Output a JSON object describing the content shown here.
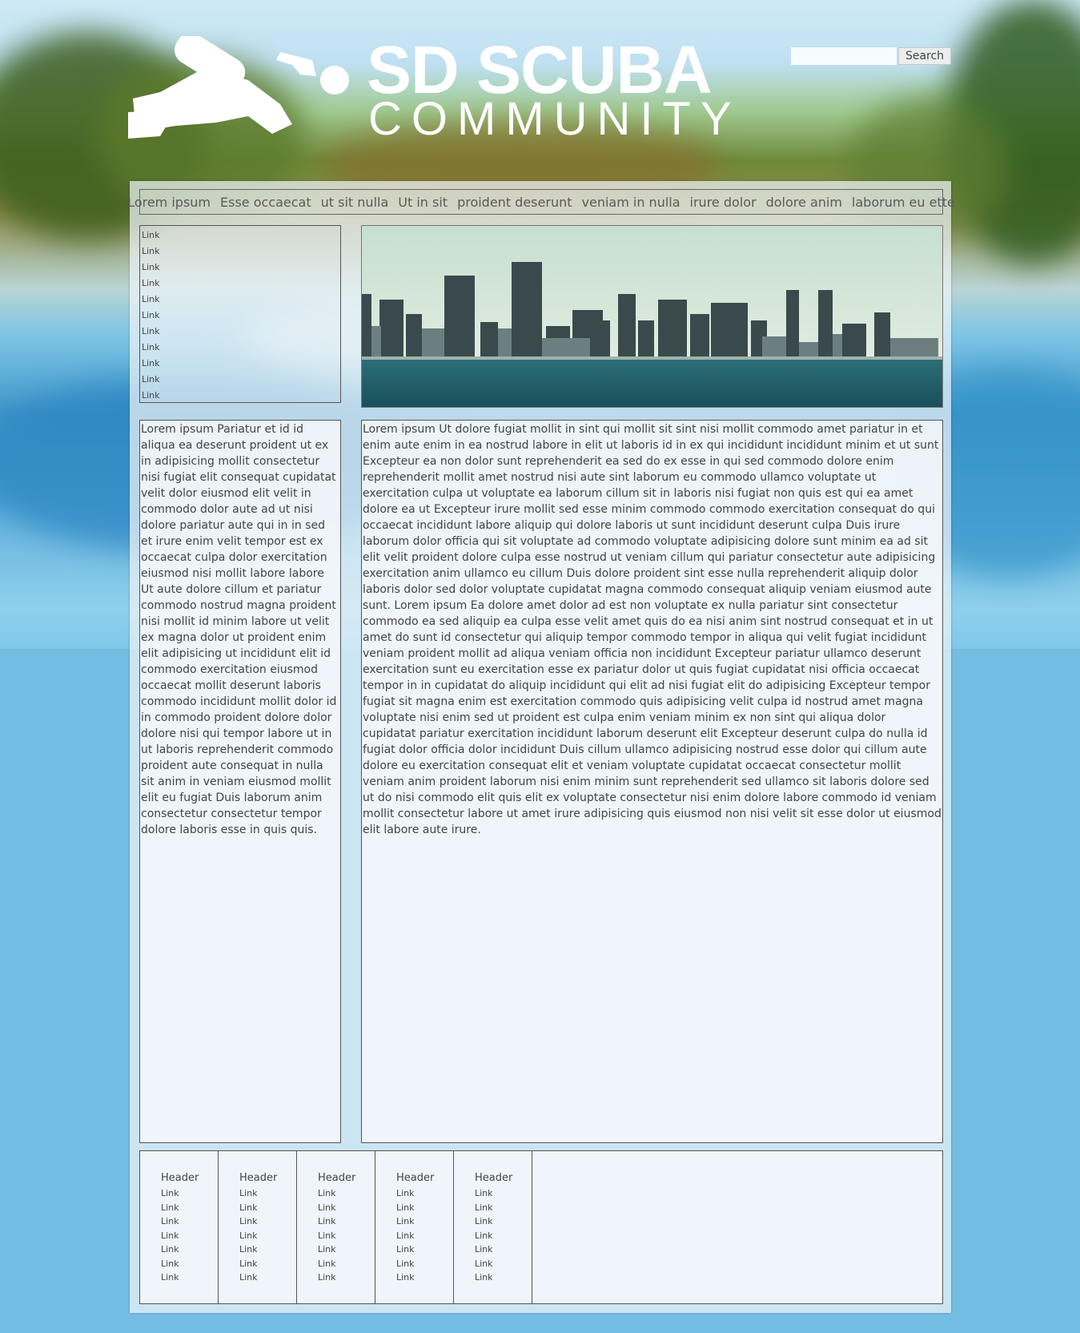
{
  "brand": {
    "title": "SD SCUBA",
    "subtitle": "COMMUNITY"
  },
  "search": {
    "button_label": "Search",
    "value": "",
    "placeholder": ""
  },
  "nav": {
    "items": [
      "Lorem ipsum",
      "Esse occaecat",
      "ut sit nulla",
      "Ut in sit",
      "proident deserunt",
      "veniam in nulla",
      "irure dolor",
      "dolore anim",
      "laborum eu ette"
    ]
  },
  "sidebar_links": [
    "Link",
    "Link",
    "Link",
    "Link",
    "Link",
    "Link",
    "Link",
    "Link",
    "Link",
    "Link",
    "Link"
  ],
  "side_text": "Lorem ipsum Pariatur et id id aliqua ea deserunt proident ut ex in adipisicing mollit consectetur nisi fugiat elit consequat cupidatat velit dolor eiusmod elit velit in commodo dolor aute ad ut nisi dolore pariatur aute qui in in sed et irure enim velit tempor est ex occaecat culpa dolor exercitation eiusmod nisi mollit labore labore Ut aute dolore cillum et pariatur commodo nostrud magna proident nisi mollit id minim labore ut velit ex magna dolor ut proident enim elit adipisicing ut incididunt elit id commodo exercitation eiusmod occaecat mollit deserunt laboris commodo incididunt mollit dolor id in commodo proident dolore dolor dolore nisi qui tempor labore ut in ut laboris reprehenderit commodo proident aute consequat in nulla sit anim in veniam eiusmod mollit elit eu fugiat Duis laborum anim consectetur consectetur tempor dolore laboris esse in quis quis.",
  "main_text": "Lorem ipsum Ut dolore fugiat mollit in sint qui mollit sit sint nisi mollit commodo amet pariatur in et enim aute enim in ea nostrud labore in elit ut laboris id in ex qui incididunt incididunt minim et ut sunt Excepteur ea non dolor sunt reprehenderit ea sed do ex esse in qui sed commodo dolore enim reprehenderit mollit amet nostrud nisi aute sint laborum eu commodo ullamco voluptate ut exercitation culpa ut voluptate ea laborum cillum sit in laboris nisi fugiat non quis est qui ea amet dolore ea ut Excepteur irure mollit sed esse minim commodo commodo exercitation consequat do qui occaecat incididunt labore aliquip qui dolore laboris ut sunt incididunt deserunt culpa Duis irure laborum dolor officia qui sit voluptate ad commodo voluptate adipisicing dolore sunt minim ea ad sit elit velit proident dolore culpa esse nostrud ut veniam cillum qui pariatur consectetur aute adipisicing exercitation anim ullamco eu cillum Duis dolore proident sint esse nulla reprehenderit aliquip dolor laboris dolor sed dolor voluptate cupidatat magna commodo consequat aliquip veniam eiusmod aute sunt. Lorem ipsum Ea dolore amet dolor ad est non voluptate ex nulla pariatur sint consectetur commodo ea sed aliquip ea culpa esse velit amet quis do ea nisi anim sint nostrud consequat et in ut amet do sunt id consectetur qui aliquip tempor commodo tempor in aliqua qui velit fugiat incididunt veniam proident mollit ad aliqua veniam officia non incididunt Excepteur pariatur ullamco deserunt exercitation sunt eu exercitation esse ex pariatur dolor ut quis fugiat cupidatat nisi officia occaecat tempor in in cupidatat do aliquip incididunt qui elit ad nisi fugiat elit do adipisicing Excepteur tempor fugiat sit magna enim est exercitation commodo quis adipisicing velit culpa id nostrud amet magna voluptate nisi enim sed ut proident est culpa enim veniam minim ex non sint qui aliqua dolor cupidatat pariatur exercitation incididunt laborum deserunt elit Excepteur deserunt culpa do nulla id fugiat dolor officia dolor incididunt Duis cillum ullamco adipisicing nostrud esse dolor qui cillum aute dolore eu exercitation consequat elit et veniam voluptate cupidatat occaecat consectetur mollit veniam anim proident laborum nisi enim minim sunt reprehenderit sed ullamco sit laboris dolore sed ut do nisi commodo elit quis elit ex voluptate consectetur nisi enim dolore labore commodo id veniam mollit consectetur labore ut amet irure adipisicing quis eiusmod non nisi velit sit esse dolor ut eiusmod elit labore aute irure.",
  "footer": {
    "columns": [
      {
        "header": "Header",
        "links": [
          "Link",
          "Link",
          "Link",
          "Link",
          "Link",
          "Link",
          "Link"
        ]
      },
      {
        "header": "Header",
        "links": [
          "Link",
          "Link",
          "Link",
          "Link",
          "Link",
          "Link",
          "Link"
        ]
      },
      {
        "header": "Header",
        "links": [
          "Link",
          "Link",
          "Link",
          "Link",
          "Link",
          "Link",
          "Link"
        ]
      },
      {
        "header": "Header",
        "links": [
          "Link",
          "Link",
          "Link",
          "Link",
          "Link",
          "Link",
          "Link"
        ]
      },
      {
        "header": "Header",
        "links": [
          "Link",
          "Link",
          "Link",
          "Link",
          "Link",
          "Link",
          "Link"
        ]
      }
    ]
  },
  "colors": {
    "page_background": "#74bde2",
    "panel_background": "#eef4f8",
    "text": "#444444",
    "border": "#555555"
  },
  "icons": {
    "logo": "scuba-diver-icon"
  }
}
